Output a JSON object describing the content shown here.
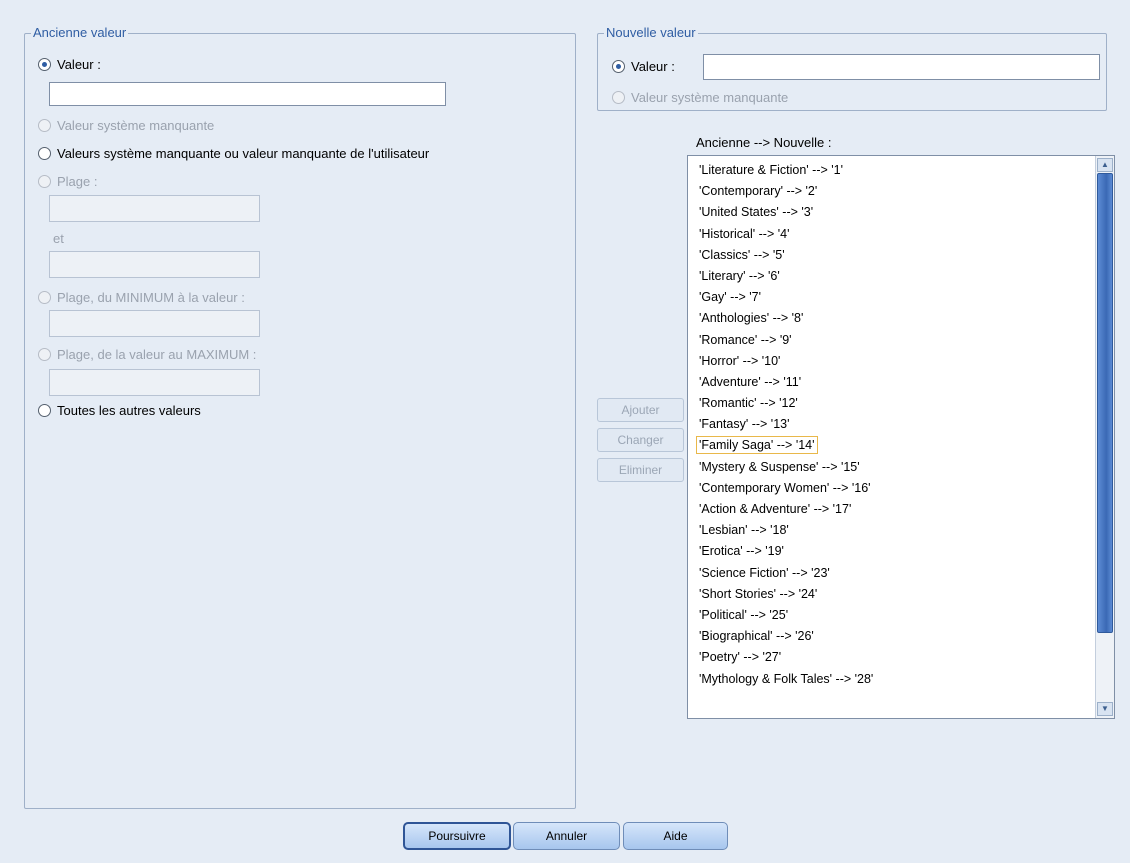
{
  "old_value": {
    "legend": "Ancienne valeur",
    "value_radio": {
      "label": "Valeur :",
      "checked": true
    },
    "value_input": "",
    "system_missing": "Valeur système manquante",
    "system_or_user_missing": "Valeurs système manquante ou valeur manquante de l'utilisateur",
    "range": "Plage :",
    "range_and": "et",
    "range_min": "Plage, du MINIMUM à la valeur :",
    "range_max": "Plage, de la valeur au MAXIMUM :",
    "all_other": "Toutes les autres valeurs"
  },
  "new_value": {
    "legend": "Nouvelle valeur",
    "value_radio": {
      "label": "Valeur :",
      "checked": true
    },
    "value_input": "",
    "system_missing": "Valeur système manquante"
  },
  "mapping": {
    "header": "Ancienne --> Nouvelle :",
    "items": [
      "'Literature & Fiction' --> '1'",
      "'Contemporary' --> '2'",
      "'United States' --> '3'",
      "'Historical' --> '4'",
      "'Classics' --> '5'",
      "'Literary' --> '6'",
      "'Gay' --> '7'",
      "'Anthologies' --> '8'",
      "'Romance' --> '9'",
      "'Horror' --> '10'",
      "'Adventure' --> '11'",
      "'Romantic' --> '12'",
      "'Fantasy' --> '13'",
      "'Family Saga' --> '14'",
      "'Mystery & Suspense' --> '15'",
      "'Contemporary Women' --> '16'",
      "'Action & Adventure' --> '17'",
      "'Lesbian' --> '18'",
      "'Erotica' --> '19'",
      "'Science Fiction' --> '23'",
      "'Short Stories' --> '24'",
      "'Political' --> '25'",
      "'Biographical' --> '26'",
      "'Poetry' --> '27'",
      "'Mythology & Folk Tales' --> '28'"
    ],
    "focused_index": 13
  },
  "side_buttons": {
    "add": "Ajouter",
    "change": "Changer",
    "remove": "Eliminer"
  },
  "footer": {
    "continue": "Poursuivre",
    "cancel": "Annuler",
    "help": "Aide"
  }
}
